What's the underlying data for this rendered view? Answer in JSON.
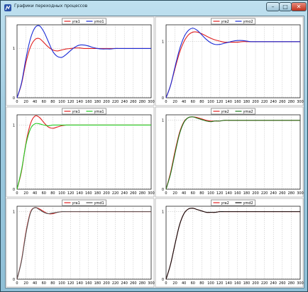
{
  "window": {
    "title": "Графики переходных процессов",
    "minimize_glyph": "–",
    "maximize_glyph": "□",
    "close_glyph": "✕",
    "icon": "app-icon"
  },
  "chart_data": [
    {
      "type": "line",
      "x": [
        0,
        10,
        20,
        30,
        40,
        50,
        60,
        70,
        80,
        90,
        100,
        110,
        120,
        130,
        140,
        150,
        160,
        170,
        180,
        190,
        200,
        210,
        220,
        230,
        240,
        250,
        260,
        270,
        280,
        290,
        300
      ],
      "x_ticks": [
        "0",
        "20",
        "40",
        "60",
        "80",
        "100",
        "120",
        "140",
        "160",
        "180",
        "200",
        "220",
        "240",
        "260",
        "280",
        "300"
      ],
      "y_ticks": [
        "0",
        "1"
      ],
      "ylim": [
        0,
        1.48
      ],
      "legend_position": "top",
      "series": [
        {
          "name": "yra1",
          "color": "#e02020",
          "values": [
            0,
            0.28,
            0.72,
            1.03,
            1.18,
            1.2,
            1.12,
            1.03,
            0.97,
            0.95,
            0.97,
            0.99,
            1.0,
            1.01,
            1.01,
            1.0,
            1.0,
            1.0,
            1.0,
            1.0,
            1.0,
            1.0,
            1.0,
            1.0,
            1.0,
            1.0,
            1.0,
            1.0,
            1.0,
            1.0,
            1.0
          ]
        },
        {
          "name": "ymo1",
          "color": "#1a2bd6",
          "values": [
            0,
            0.3,
            0.8,
            1.2,
            1.42,
            1.46,
            1.34,
            1.14,
            0.94,
            0.84,
            0.82,
            0.88,
            0.96,
            1.03,
            1.07,
            1.07,
            1.05,
            1.02,
            1.0,
            0.99,
            0.99,
            0.99,
            1.0,
            1.0,
            1.0,
            1.0,
            1.0,
            1.0,
            1.0,
            1.0,
            1.0
          ]
        }
      ]
    },
    {
      "type": "line",
      "x": [
        0,
        10,
        20,
        30,
        40,
        50,
        60,
        70,
        80,
        90,
        100,
        110,
        120,
        130,
        140,
        150,
        160,
        170,
        180,
        190,
        200,
        210,
        220,
        230,
        240,
        250,
        260,
        270,
        280,
        290,
        300
      ],
      "x_ticks": [
        "0",
        "20",
        "40",
        "60",
        "80",
        "100",
        "120",
        "140",
        "160",
        "180",
        "200",
        "220",
        "240",
        "260",
        "280",
        "300"
      ],
      "y_ticks": [
        "0",
        "1"
      ],
      "ylim": [
        0,
        1.3
      ],
      "legend_position": "top",
      "series": [
        {
          "name": "yra2",
          "color": "#e02020",
          "values": [
            0,
            0.22,
            0.52,
            0.8,
            1.0,
            1.12,
            1.17,
            1.17,
            1.14,
            1.1,
            1.06,
            1.03,
            1.01,
            0.99,
            0.99,
            0.99,
            0.99,
            1.0,
            1.0,
            1.0,
            1.0,
            1.0,
            1.0,
            1.0,
            1.0,
            1.0,
            1.0,
            1.0,
            1.0,
            1.0,
            1.0
          ]
        },
        {
          "name": "ymo2",
          "color": "#1a2bd6",
          "values": [
            0,
            0.22,
            0.55,
            0.86,
            1.08,
            1.2,
            1.24,
            1.2,
            1.12,
            1.04,
            0.98,
            0.95,
            0.95,
            0.97,
            0.99,
            1.01,
            1.02,
            1.02,
            1.01,
            1.0,
            1.0,
            1.0,
            1.0,
            1.0,
            1.0,
            1.0,
            1.0,
            1.0,
            1.0,
            1.0,
            1.0
          ]
        }
      ]
    },
    {
      "type": "line",
      "x": [
        0,
        10,
        20,
        30,
        40,
        50,
        60,
        70,
        80,
        90,
        100,
        110,
        120,
        130,
        140,
        150,
        160,
        170,
        180,
        190,
        200,
        210,
        220,
        230,
        240,
        250,
        260,
        270,
        280,
        290,
        300
      ],
      "x_ticks": [
        "0",
        "20",
        "40",
        "60",
        "80",
        "100",
        "120",
        "140",
        "160",
        "180",
        "200",
        "220",
        "240",
        "260",
        "280",
        "300"
      ],
      "y_ticks": [
        "0",
        "1"
      ],
      "ylim": [
        0,
        1.16
      ],
      "legend_position": "top",
      "series": [
        {
          "name": "yra1",
          "color": "#e02020",
          "values": [
            0,
            0.28,
            0.72,
            1.02,
            1.14,
            1.12,
            1.04,
            0.97,
            0.95,
            0.97,
            0.99,
            1.0,
            1.0,
            1.0,
            1.0,
            1.0,
            1.0,
            1.0,
            1.0,
            1.0,
            1.0,
            1.0,
            1.0,
            1.0,
            1.0,
            1.0,
            1.0,
            1.0,
            1.0,
            1.0,
            1.0
          ]
        },
        {
          "name": "yma1",
          "color": "#22cc22",
          "values": [
            0,
            0.3,
            0.7,
            0.94,
            1.02,
            1.02,
            1.0,
            0.99,
            1.0,
            1.0,
            1.0,
            1.0,
            1.0,
            1.0,
            1.0,
            1.0,
            1.0,
            1.0,
            1.0,
            1.0,
            1.0,
            1.0,
            1.0,
            1.0,
            1.0,
            1.0,
            1.0,
            1.0,
            1.0,
            1.0,
            1.0
          ]
        }
      ]
    },
    {
      "type": "line",
      "x": [
        0,
        10,
        20,
        30,
        40,
        50,
        60,
        70,
        80,
        90,
        100,
        110,
        120,
        130,
        140,
        150,
        160,
        170,
        180,
        190,
        200,
        210,
        220,
        230,
        240,
        250,
        260,
        270,
        280,
        290,
        300
      ],
      "x_ticks": [
        "0",
        "20",
        "40",
        "60",
        "80",
        "100",
        "120",
        "140",
        "160",
        "180",
        "200",
        "220",
        "240",
        "260",
        "280",
        "300"
      ],
      "y_ticks": [
        "0",
        "1"
      ],
      "ylim": [
        0,
        1.08
      ],
      "legend_position": "top",
      "series": [
        {
          "name": "yra2",
          "color": "#e02020",
          "values": [
            0,
            0.24,
            0.55,
            0.82,
            0.98,
            1.04,
            1.05,
            1.04,
            1.02,
            1.0,
            0.99,
            0.99,
            0.99,
            1.0,
            1.0,
            1.0,
            1.0,
            1.0,
            1.0,
            1.0,
            1.0,
            1.0,
            1.0,
            1.0,
            1.0,
            1.0,
            1.0,
            1.0,
            1.0,
            1.0,
            1.0
          ]
        },
        {
          "name": "yma2",
          "color": "#1f7a1f",
          "values": [
            0,
            0.22,
            0.52,
            0.8,
            0.97,
            1.04,
            1.05,
            1.03,
            1.01,
            0.99,
            0.98,
            0.99,
            0.99,
            1.0,
            1.0,
            1.0,
            1.0,
            1.0,
            1.0,
            1.0,
            1.0,
            1.0,
            1.0,
            1.0,
            1.0,
            1.0,
            1.0,
            1.0,
            1.0,
            1.0,
            1.0
          ]
        }
      ]
    },
    {
      "type": "line",
      "x": [
        0,
        10,
        20,
        30,
        40,
        50,
        60,
        70,
        80,
        90,
        100,
        110,
        120,
        130,
        140,
        150,
        160,
        170,
        180,
        190,
        200,
        210,
        220,
        230,
        240,
        250,
        260,
        270,
        280,
        290,
        300
      ],
      "x_ticks": [
        "0",
        "20",
        "40",
        "60",
        "80",
        "100",
        "120",
        "140",
        "160",
        "180",
        "200",
        "220",
        "240",
        "260",
        "280",
        "300"
      ],
      "y_ticks": [
        "0",
        "1"
      ],
      "ylim": [
        0,
        1.08
      ],
      "legend_position": "top",
      "series": [
        {
          "name": "yra1",
          "color": "#e02020",
          "values": [
            0,
            0.28,
            0.7,
            0.99,
            1.06,
            1.04,
            1.0,
            0.97,
            0.97,
            0.99,
            1.0,
            1.0,
            1.0,
            1.0,
            1.0,
            1.0,
            1.0,
            1.0,
            1.0,
            1.0,
            1.0,
            1.0,
            1.0,
            1.0,
            1.0,
            1.0,
            1.0,
            1.0,
            1.0,
            1.0,
            1.0
          ]
        },
        {
          "name": "ymd1",
          "color": "#555555",
          "values": [
            0,
            0.27,
            0.68,
            0.98,
            1.06,
            1.03,
            0.99,
            0.97,
            0.98,
            0.99,
            1.0,
            1.0,
            1.0,
            1.0,
            1.0,
            1.0,
            1.0,
            1.0,
            1.0,
            1.0,
            1.0,
            1.0,
            1.0,
            1.0,
            1.0,
            1.0,
            1.0,
            1.0,
            1.0,
            1.0,
            1.0
          ]
        }
      ]
    },
    {
      "type": "line",
      "x": [
        0,
        10,
        20,
        30,
        40,
        50,
        60,
        70,
        80,
        90,
        100,
        110,
        120,
        130,
        140,
        150,
        160,
        170,
        180,
        190,
        200,
        210,
        220,
        230,
        240,
        250,
        260,
        270,
        280,
        290,
        300
      ],
      "x_ticks": [
        "0",
        "20",
        "40",
        "60",
        "80",
        "100",
        "120",
        "140",
        "160",
        "180",
        "200",
        "220",
        "240",
        "260",
        "280",
        "300"
      ],
      "y_ticks": [
        "0",
        "1"
      ],
      "ylim": [
        0,
        1.08
      ],
      "legend_position": "top",
      "series": [
        {
          "name": "yra2",
          "color": "#e02020",
          "values": [
            0,
            0.22,
            0.52,
            0.8,
            0.97,
            1.04,
            1.05,
            1.03,
            1.01,
            0.99,
            0.99,
            0.99,
            1.0,
            1.0,
            1.0,
            1.0,
            1.0,
            1.0,
            1.0,
            1.0,
            1.0,
            1.0,
            1.0,
            1.0,
            1.0,
            1.0,
            1.0,
            1.0,
            1.0,
            1.0,
            1.0
          ]
        },
        {
          "name": "ymd2",
          "color": "#111111",
          "values": [
            0,
            0.22,
            0.52,
            0.8,
            0.97,
            1.04,
            1.05,
            1.03,
            1.01,
            0.99,
            0.99,
            0.99,
            1.0,
            1.0,
            1.0,
            1.0,
            1.0,
            1.0,
            1.0,
            1.0,
            1.0,
            1.0,
            1.0,
            1.0,
            1.0,
            1.0,
            1.0,
            1.0,
            1.0,
            1.0,
            1.0
          ]
        }
      ]
    }
  ]
}
